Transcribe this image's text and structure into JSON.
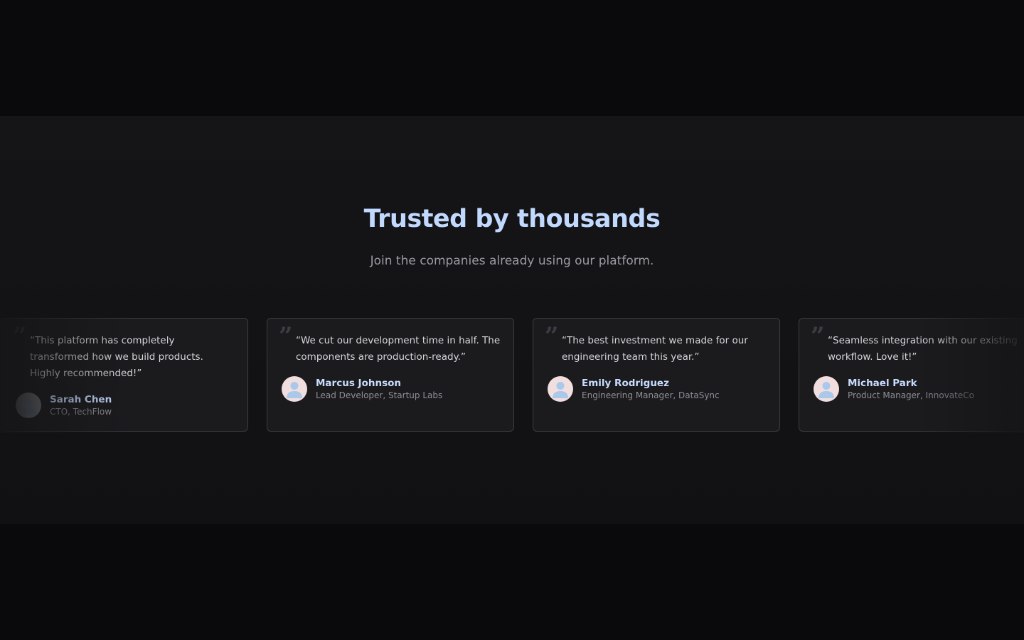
{
  "testimonials_section": {
    "heading": "Trusted by thousands",
    "subheading": "Join the companies already using our platform."
  },
  "testimonials": [
    {
      "quote": "“This platform has completely transformed how we build products. Highly recommended!”",
      "name": "Sarah Chen",
      "role": "CTO, TechFlow",
      "avatar_icon": "user-avatar-icon"
    },
    {
      "quote": "“We cut our development time in half. The components are production-ready.”",
      "name": "Marcus Johnson",
      "role": "Lead Developer, Startup Labs",
      "avatar_icon": "user-avatar-icon"
    },
    {
      "quote": "“The best investment we made for our engineering team this year.”",
      "name": "Emily Rodriguez",
      "role": "Engineering Manager, DataSync",
      "avatar_icon": "user-avatar-icon"
    },
    {
      "quote": "“Seamless integration with our existing workflow. Love it!”",
      "name": "Michael Park",
      "role": "Product Manager, InnovateCo",
      "avatar_icon": "user-avatar-icon"
    }
  ],
  "colors": {
    "page_background": "#0a0a0c",
    "section_background": "#151517",
    "card_background": "#1b1b1e",
    "card_border": "#3b3b42",
    "heading": "#c2d9ff",
    "author_name": "#c8dcff",
    "avatar_background": "#f1dfe0",
    "avatar_figure": "#a9c8ea"
  }
}
